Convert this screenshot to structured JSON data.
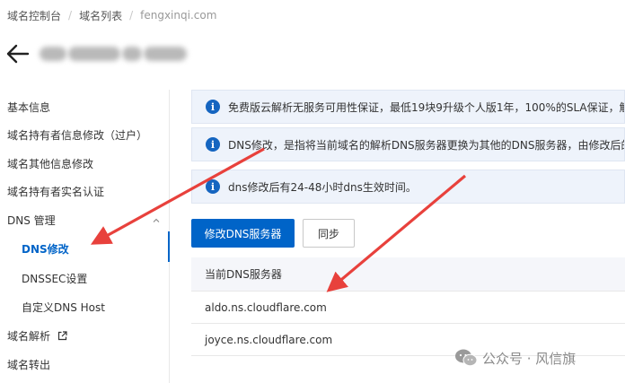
{
  "breadcrumb": {
    "items": [
      "域名控制台",
      "域名列表",
      "fengxinqi.com"
    ]
  },
  "header": {
    "back_icon": "arrow-left-icon"
  },
  "sidebar": {
    "items": [
      {
        "label": "基本信息"
      },
      {
        "label": "域名持有者信息修改（过户）"
      },
      {
        "label": "域名其他信息修改"
      },
      {
        "label": "域名持有者实名认证"
      }
    ],
    "group": {
      "label": "DNS 管理",
      "expanded": true
    },
    "sub_items": [
      {
        "label": "DNS修改",
        "active": true
      },
      {
        "label": "DNSSEC设置"
      },
      {
        "label": "自定义DNS Host"
      }
    ],
    "tail_items": [
      {
        "label": "域名解析",
        "external_icon": "external-link-icon"
      },
      {
        "label": "域名转出"
      }
    ]
  },
  "notices": [
    {
      "icon": "info-icon",
      "text": "免费版云解析无服务可用性保证，最低19块9升级个人版1年，100%的SLA保证，解析"
    },
    {
      "icon": "info-icon",
      "text": "DNS修改，是指将当前域名的解析DNS服务器更换为其他的DNS服务器，由修改后的"
    },
    {
      "icon": "info-icon",
      "text": "dns修改后有24-48小时dns生效时间。"
    }
  ],
  "actions": {
    "modify_label": "修改DNS服务器",
    "sync_label": "同步"
  },
  "dns_table": {
    "header": "当前DNS服务器",
    "rows": [
      "aldo.ns.cloudflare.com",
      "joyce.ns.cloudflare.com"
    ]
  },
  "watermark": {
    "text": "公众号 · 风信旗",
    "icon": "wechat-icon"
  },
  "colors": {
    "accent": "#0064c8",
    "annotation_arrow": "#e8413c",
    "notice_bg": "#eef3fb"
  }
}
